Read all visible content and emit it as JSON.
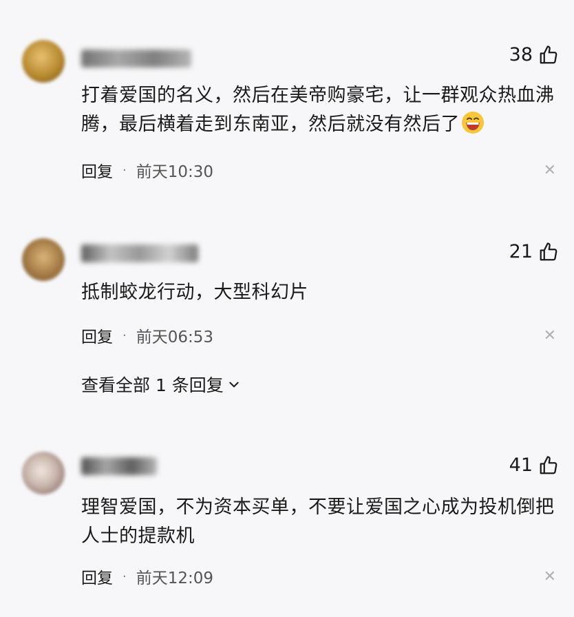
{
  "comments": [
    {
      "likes": "38",
      "text_line1": "打着爱国的名义，然后在美帝购豪宅，让一群观众热血沸",
      "text_line2": "腾，最后横着走到东南亚，然后就没有然后了",
      "reply_label": "回复",
      "time": "前天10:30",
      "emoji_icon": "grinning-face-emoji"
    },
    {
      "likes": "21",
      "text_line1": "抵制蛟龙行动，大型科幻片",
      "reply_label": "回复",
      "time": "前天06:53",
      "view_replies_label": "查看全部 1 条回复"
    },
    {
      "likes": "41",
      "text_line1": "理智爱国，不为资本买单，不要让爱国之心成为投机倒把",
      "text_line2": "人士的提款机",
      "reply_label": "回复",
      "time": "前天12:09"
    }
  ],
  "icons": {
    "like": "thumbs-up-icon",
    "close": "close-icon",
    "chevron": "chevron-down-icon"
  },
  "colors": {
    "background": "#f7f7f9",
    "text": "#1a1a1a",
    "secondary": "#555555",
    "close": "#b0b0b0"
  }
}
